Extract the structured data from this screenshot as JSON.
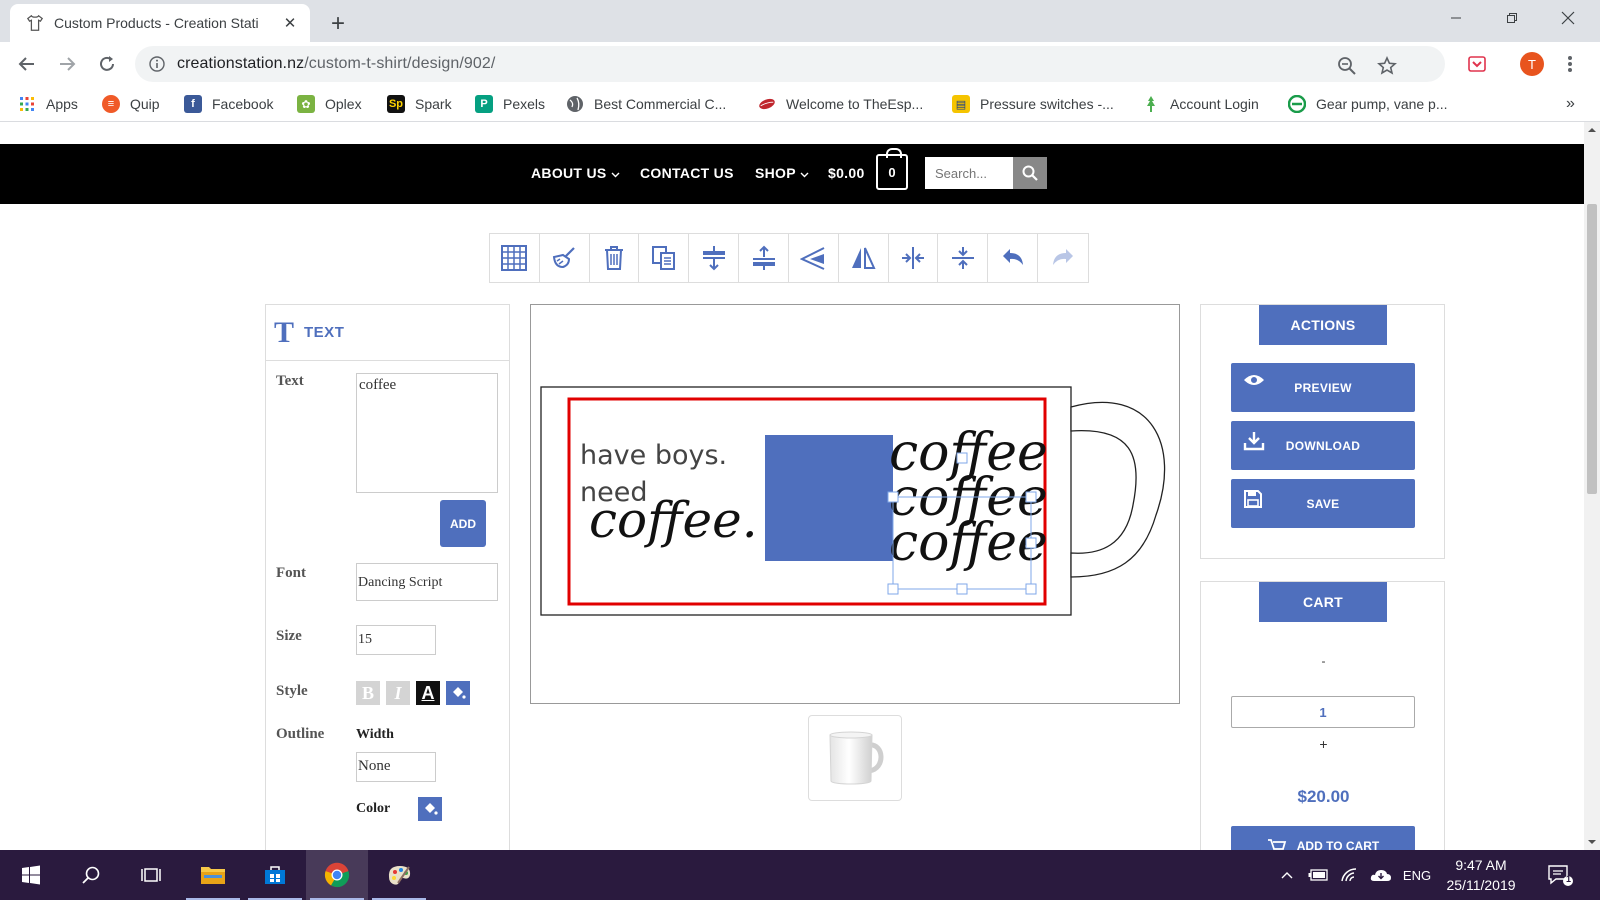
{
  "browser": {
    "tab_title": "Custom Products - Creation Stati",
    "url_domain": "creationstation.nz",
    "url_path": "/custom-t-shirt/design/902/",
    "profile_initial": "T",
    "bookmarks": [
      {
        "label": "Apps",
        "icon": "apps-grid-icon"
      },
      {
        "label": "Quip",
        "icon": "quip-icon",
        "color": "#f05a28"
      },
      {
        "label": "Facebook",
        "icon": "facebook-icon",
        "color": "#3b5998"
      },
      {
        "label": "Oplex",
        "icon": "oplex-icon",
        "color": "#7bb342"
      },
      {
        "label": "Spark",
        "icon": "spark-icon",
        "color": "#111111"
      },
      {
        "label": "Pexels",
        "icon": "pexels-icon",
        "color": "#05a081"
      },
      {
        "label": "Best Commercial C...",
        "icon": "globe-icon"
      },
      {
        "label": "Welcome to TheEsp...",
        "icon": "coffee-bean-icon",
        "color": "#c0262d"
      },
      {
        "label": "Pressure switches -...",
        "icon": "pressure-switch-icon",
        "color": "#f5c400"
      },
      {
        "label": "Account Login",
        "icon": "account-login-icon",
        "color": "#4caf50"
      },
      {
        "label": "Gear pump, vane p...",
        "icon": "gear-pump-icon",
        "color": "#1a9c4a"
      }
    ],
    "more": "»"
  },
  "site_nav": {
    "about": "ABOUT US",
    "contact": "CONTACT US",
    "shop": "SHOP",
    "cart_total": "$0.00",
    "cart_count": "0",
    "search_placeholder": "Search..."
  },
  "toolbar": {
    "tools": [
      "grid-icon",
      "clear-icon",
      "trash-icon",
      "duplicate-icon",
      "align-vertical-center-icon",
      "align-horizontal-center-icon",
      "send-backward-icon",
      "flip-icon",
      "center-horizontal-icon",
      "center-vertical-icon",
      "undo-icon",
      "redo-icon"
    ]
  },
  "text_panel": {
    "title": "TEXT",
    "text_label": "Text",
    "text_value": "coffee",
    "add_label": "ADD",
    "font_label": "Font",
    "font_value": "Dancing Script",
    "size_label": "Size",
    "size_value": "15",
    "style_label": "Style",
    "style_bold": "B",
    "style_italic": "I",
    "style_color": "A",
    "outline_label": "Outline",
    "width_label": "Width",
    "width_value": "None",
    "color_label": "Color"
  },
  "canvas": {
    "line1": "have boys.",
    "line2": "need",
    "script_word": "coffee.",
    "stack_word": "coffee",
    "colors": {
      "frame": "#e10000",
      "swatch": "#4f6fbd"
    }
  },
  "actions": {
    "header": "ACTIONS",
    "preview": "PREVIEW",
    "download": "DOWNLOAD",
    "save": "SAVE"
  },
  "cart": {
    "header": "CART",
    "minus": "-",
    "quantity": "1",
    "plus": "+",
    "price": "$20.00",
    "add_to_cart": "ADD TO CART"
  },
  "taskbar": {
    "time": "9:47 AM",
    "date": "25/11/2019",
    "language": "ENG",
    "notifications": "1"
  },
  "theme": {
    "accent": "#4f6fbd",
    "nav_bg": "#000000"
  }
}
